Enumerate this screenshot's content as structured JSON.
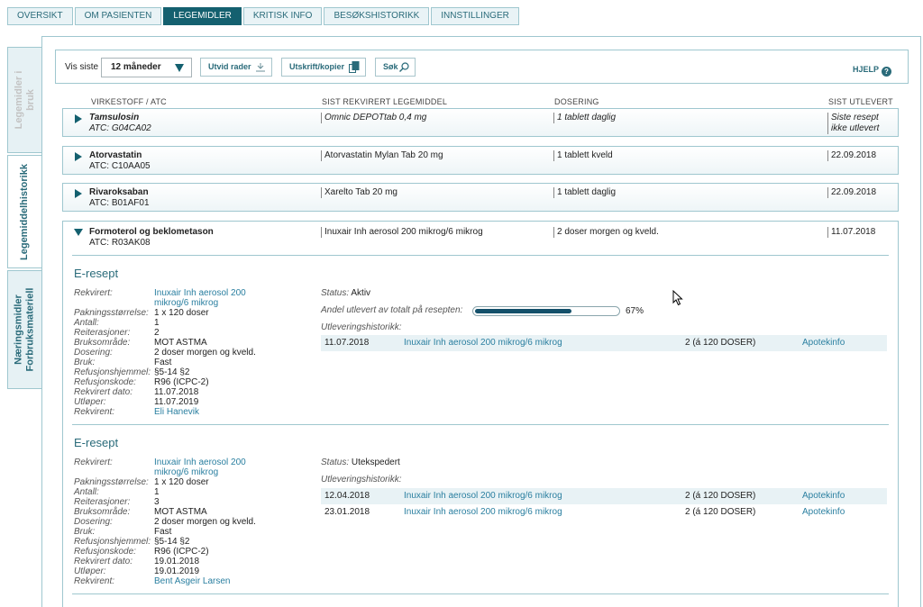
{
  "top_tabs": [
    "OVERSIKT",
    "OM PASIENTEN",
    "LEGEMIDLER",
    "KRITISK INFO",
    "BESØKSHISTORIKK",
    "INNSTILLINGER"
  ],
  "active_top_tab": "LEGEMIDLER",
  "side_tabs": {
    "in_use": "Legemidler i bruk",
    "history": "Legemiddelhistorikk",
    "nutrition_line1": "Næringsmidler",
    "nutrition_line2": "Forbruksmateriell"
  },
  "toolbar": {
    "show_label": "Vis siste",
    "period_value": "12 måneder",
    "expand_label": "Utvid rader",
    "print_label": "Utskrift/kopier",
    "search_label": "Søk",
    "help_label": "HJELP"
  },
  "columns": [
    "VIRKESTOFF / ATC",
    "SIST REKVIRERT LEGEMIDDEL",
    "DOSERING",
    "SIST UTLEVERT"
  ],
  "medications": [
    {
      "name": "Tamsulosin",
      "atc": "ATC: G04CA02",
      "drug": "Omnic DEPOTtab 0,4 mg",
      "dose": "1 tablett daglig",
      "dispensed1": "Siste resept",
      "dispensed2": "ikke utlevert"
    },
    {
      "name": "Atorvastatin",
      "atc": "ATC: C10AA05",
      "drug": "Atorvastatin Mylan Tab 20 mg",
      "dose": "1 tablett kveld",
      "dispensed1": "22.09.2018"
    },
    {
      "name": "Rivaroksaban",
      "atc": "ATC: B01AF01",
      "drug": "Xarelto Tab 20 mg",
      "dose": "1 tablett daglig",
      "dispensed1": "22.09.2018"
    },
    {
      "name": "Formoterol og beklometason",
      "atc": "ATC: R03AK08",
      "drug": "Inuxair Inh aerosol 200 mikrog/6 mikrog",
      "dose": "2 doser morgen og kveld.",
      "dispensed1": "11.07.2018"
    }
  ],
  "prescriptions": [
    {
      "heading": "E-resept",
      "labels": [
        "Rekvirert:",
        "Pakningsstørrelse:",
        "Antall:",
        "Reiterasjoner:",
        "Bruksområde:",
        "Dosering:",
        "Bruk:",
        "Refusjonshjemmel:",
        "Refusjonskode:",
        "Rekvirert dato:",
        "Utløper:",
        "Rekvirent:"
      ],
      "drug_line1": "Inuxair Inh aerosol 200",
      "drug_line2": "mikrog/6 mikrog",
      "pack": "1 x 120 doser",
      "count": "1",
      "reiterations": "2",
      "area": "MOT ASTMA",
      "dosing": "2 doser morgen og kveld.",
      "use": "Fast",
      "refund_basis": "§5-14 §2",
      "refund_code": "R96 (ICPC-2)",
      "ordered_date": "11.07.2018",
      "expires": "11.07.2019",
      "prescriber": "Eli Hanevik",
      "status_label": "Status:",
      "status": "Aktiv",
      "share_label": "Andel utlevert av totalt på resepten:",
      "share_percent": 67,
      "share_text": "67%",
      "history_label": "Utleveringshistorikk:",
      "history": [
        {
          "date": "11.07.2018",
          "drug": "Inuxair Inh aerosol 200 mikrog/6 mikrog",
          "amount": "2 (á 120 DOSER)",
          "link": "Apotekinfo"
        }
      ]
    },
    {
      "heading": "E-resept",
      "drug_line1": "Inuxair Inh aerosol 200",
      "drug_line2": "mikrog/6 mikrog",
      "pack": "1 x 120 doser",
      "count": "1",
      "reiterations": "3",
      "area": "MOT ASTMA",
      "dosing": "2 doser morgen og kveld.",
      "use": "Fast",
      "refund_basis": "§5-14 §2",
      "refund_code": "R96 (ICPC-2)",
      "ordered_date": "19.01.2018",
      "expires": "19.01.2019",
      "prescriber": "Bent Asgeir Larsen",
      "status_label": "Status:",
      "status": "Utekspedert",
      "history_label": "Utleveringshistorikk:",
      "history": [
        {
          "date": "12.04.2018",
          "drug": "Inuxair Inh aerosol 200 mikrog/6 mikrog",
          "amount": "2 (á 120 DOSER)",
          "link": "Apotekinfo"
        },
        {
          "date": "23.01.2018",
          "drug": "Inuxair Inh aerosol 200 mikrog/6 mikrog",
          "amount": "2 (á 120 DOSER)",
          "link": "Apotekinfo"
        }
      ]
    }
  ],
  "colors": {
    "accent": "#14606f",
    "link": "#2a7fa0",
    "border": "#9fc7cf"
  }
}
